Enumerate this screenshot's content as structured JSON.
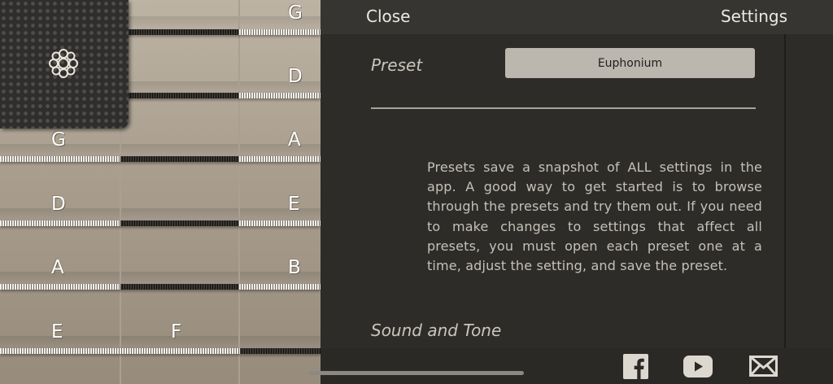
{
  "fretboard": {
    "notes": {
      "g_top": "G",
      "d_top": "D",
      "g_mid": "G",
      "a_mid": "A",
      "d_left": "D",
      "e_right": "E",
      "a_left": "A",
      "b_right": "B",
      "e_left": "E",
      "f_mid": "F"
    }
  },
  "header": {
    "close_label": "Close",
    "title": "Settings"
  },
  "preset": {
    "label": "Preset",
    "selected_value": "Euphonium",
    "description": "Presets save a snapshot of ALL settings in the app. A good way to get started is to browse through the presets and try them out. If you need to make changes to settings that affect all presets, you must open each preset one at a time, adjust the setting, and save the preset."
  },
  "sound": {
    "label": "Sound and Tone"
  },
  "footer": {
    "icons": [
      "facebook-icon",
      "youtube-icon",
      "mail-icon"
    ]
  },
  "colors": {
    "panel_bg": "#2e2c29",
    "topbar_bg": "#373531",
    "select_bg": "#bcb7ae",
    "text_light": "#ece9e3"
  }
}
